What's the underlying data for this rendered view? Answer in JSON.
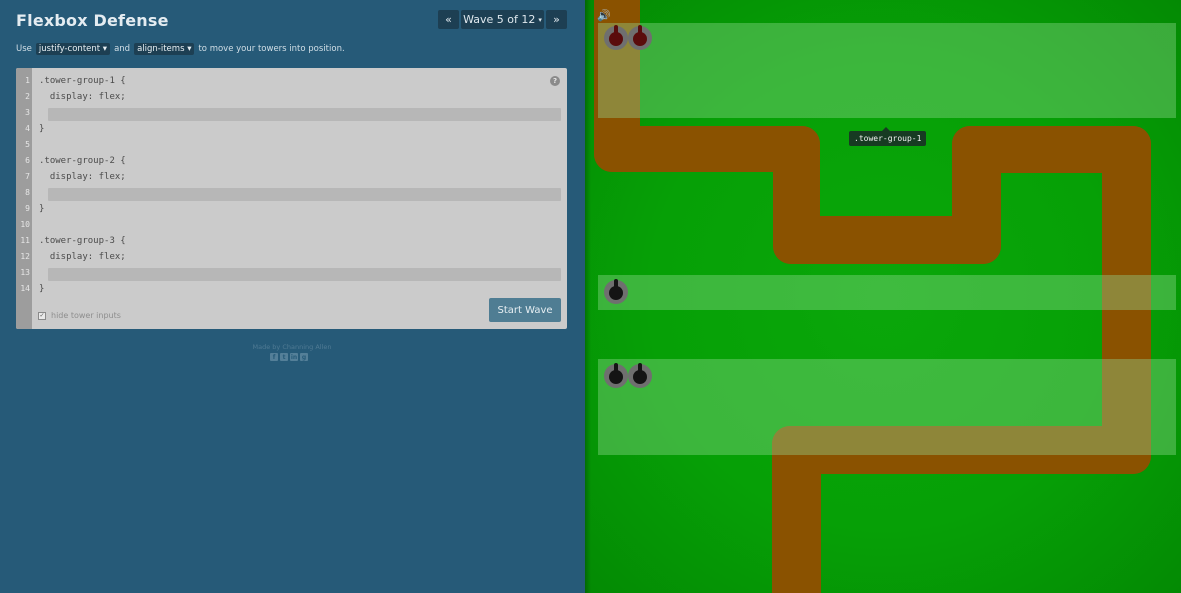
{
  "header": {
    "title": "Flexbox Defense",
    "prev_icon": "«",
    "next_icon": "»",
    "wave_label": "Wave 5 of 12",
    "wave_caret": "▾"
  },
  "instructions": {
    "prefix": "Use",
    "select1": "justify-content ▾",
    "middle": "and",
    "select2": "align-items ▾",
    "suffix": "to move your towers into position."
  },
  "editor": {
    "line_numbers": [
      "1",
      "2",
      "3",
      "4",
      "5",
      "6",
      "7",
      "8",
      "9",
      "10",
      "11",
      "12",
      "13",
      "14"
    ],
    "lines": [
      ".tower-group-1 {",
      "  display: flex;",
      "",
      "}",
      "",
      ".tower-group-2 {",
      "  display: flex;",
      "",
      "}",
      "",
      ".tower-group-3 {",
      "  display: flex;",
      "",
      "}"
    ],
    "help_icon": "?",
    "hide_label": "hide tower inputs",
    "hide_checked_mark": "✓",
    "start_button": "Start Wave"
  },
  "footer": {
    "credit": "Made by Channing Allen",
    "social_icons": [
      "facebook-icon",
      "twitter-icon",
      "linkedin-icon",
      "github-icon"
    ],
    "social_glyphs": [
      "f",
      "t",
      "in",
      "g"
    ]
  },
  "board": {
    "speaker_icon": "🔊",
    "tooltip": ".tower-group-1",
    "colors": {
      "grass": "#06a006",
      "path": "#8a5200",
      "group_zone": "rgba(150,220,150,0.38)"
    }
  }
}
